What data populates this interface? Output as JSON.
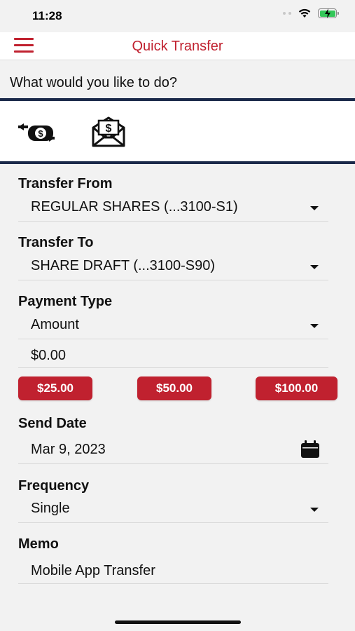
{
  "status_bar": {
    "time": "11:28"
  },
  "nav": {
    "title": "Quick Transfer"
  },
  "prompt": "What would you like to do?",
  "actions": [
    {
      "icon": "money-transfer-icon"
    },
    {
      "icon": "envelope-dollar-icon"
    }
  ],
  "form": {
    "transfer_from": {
      "label": "Transfer From",
      "value": "REGULAR SHARES (...3100-S1)"
    },
    "transfer_to": {
      "label": "Transfer To",
      "value": "SHARE DRAFT (...3100-S90)"
    },
    "payment_type": {
      "label": "Payment Type",
      "value": "Amount",
      "amount": "$0.00"
    },
    "quick_amounts": [
      "$25.00",
      "$50.00",
      "$100.00"
    ],
    "send_date": {
      "label": "Send Date",
      "value": "Mar 9, 2023"
    },
    "frequency": {
      "label": "Frequency",
      "value": "Single"
    },
    "memo": {
      "label": "Memo",
      "value": "Mobile App Transfer"
    }
  },
  "colors": {
    "accent": "#c0212f",
    "divider": "#1b2a4a",
    "background": "#f2f2f2"
  }
}
